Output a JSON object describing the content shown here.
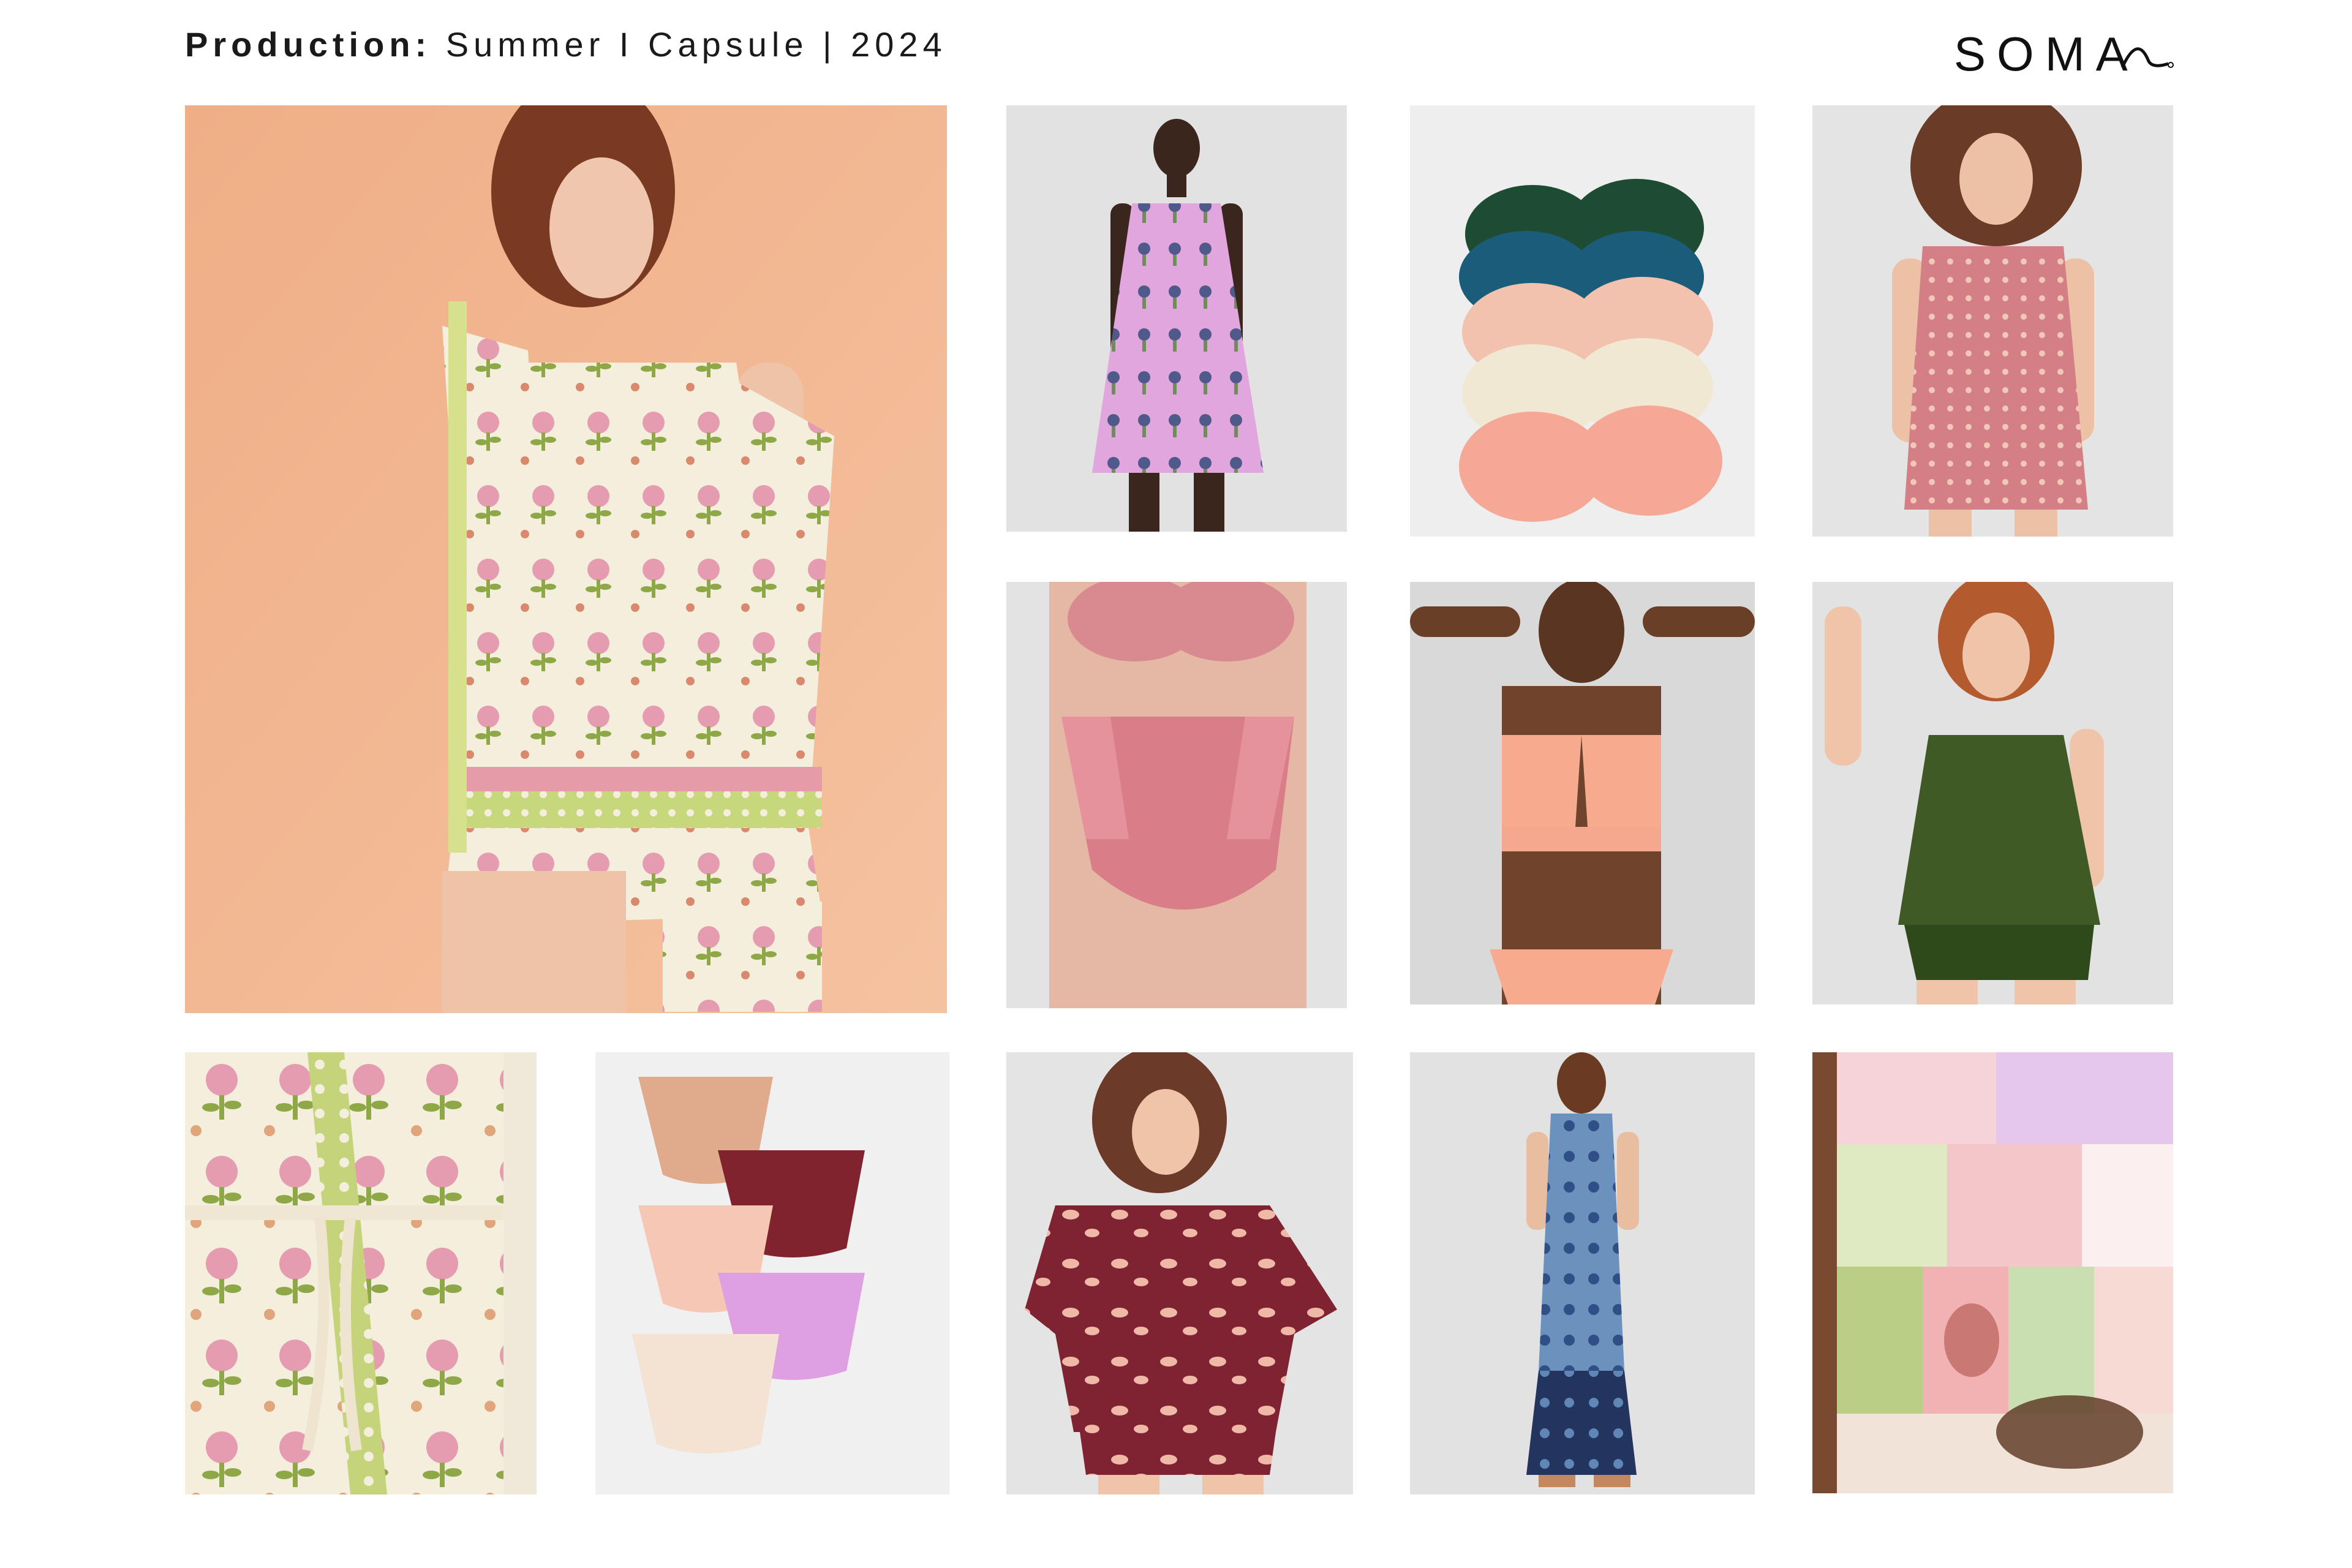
{
  "header": {
    "label": "Production:",
    "collection": "Summer I Capsule | 2024"
  },
  "brand": {
    "name": "SOMA"
  },
  "colors": {
    "text": "#1a1a1a",
    "background": "#ffffff",
    "tile_gray": "#e4e3e3",
    "peach_wall": "#f0b48e",
    "cream_print": "#f4eedd",
    "pink_print": "#e59bb0",
    "green_print": "#8fa847",
    "lilac": "#e0a3dc",
    "rose": "#d47f86",
    "olive": "#3f5a25",
    "burgundy": "#7f2332",
    "denim_blue": "#5f86b4",
    "navy": "#23345e",
    "peach_lace": "#f6ab8f"
  },
  "tiles": [
    {
      "id": "hero-robe-chemise",
      "subject": "floral print chemise and robe"
    },
    {
      "id": "lilac-racerback-sleepshirt",
      "subject": "lilac printed racerback sleep dress"
    },
    {
      "id": "bra-stack",
      "subject": "stack of bras"
    },
    {
      "id": "rose-sleepshirt",
      "subject": "rose geometric print sleep dress"
    },
    {
      "id": "pink-lace-briefs",
      "subject": "pink lace high waist brief"
    },
    {
      "id": "peach-lace-bralette",
      "subject": "peach lace bralette set"
    },
    {
      "id": "olive-cami-set",
      "subject": "olive cami and short set"
    },
    {
      "id": "robe-detail",
      "subject": "robe belt detail"
    },
    {
      "id": "panty-stack",
      "subject": "stack of bikini panties"
    },
    {
      "id": "burgundy-pajama-set",
      "subject": "burgundy floral robe set"
    },
    {
      "id": "blue-halter-maxi",
      "subject": "blue print halter maxi dress"
    },
    {
      "id": "patchwork-shorts",
      "subject": "patchwork print shorts detail"
    }
  ]
}
